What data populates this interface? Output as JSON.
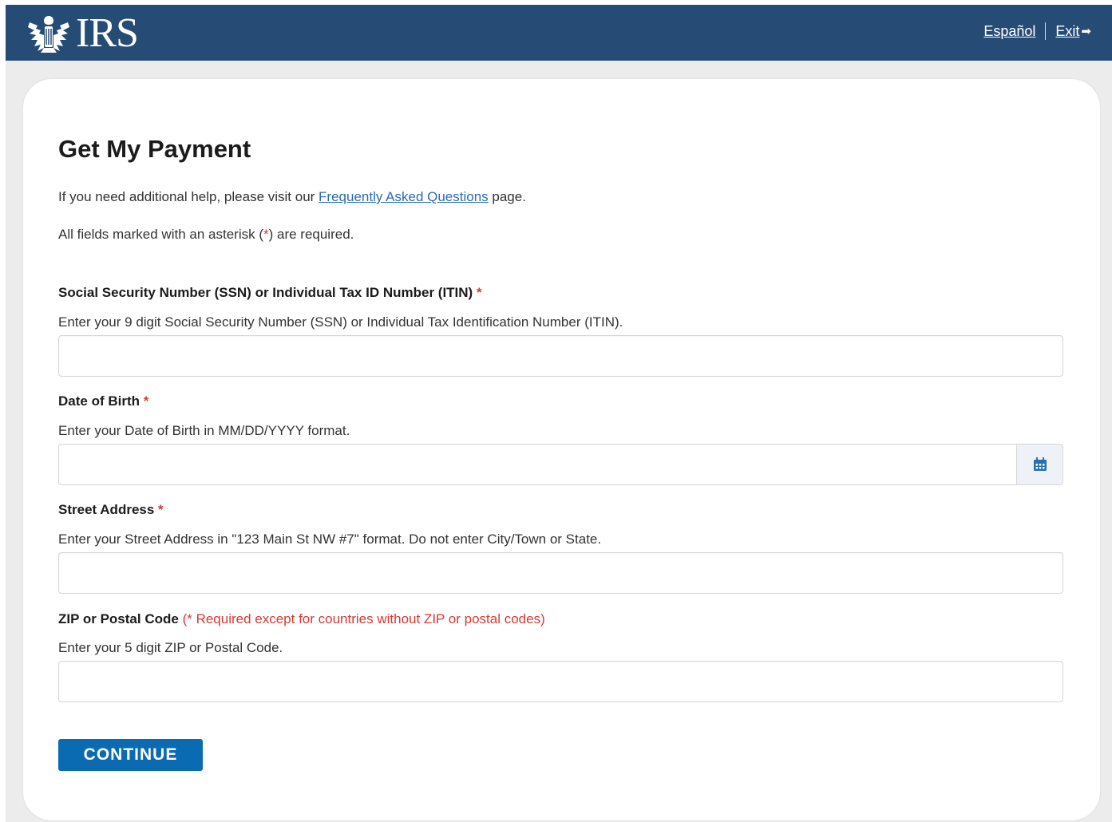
{
  "header": {
    "logo_text": "IRS",
    "espanol_link": "Español",
    "exit_link": "Exit"
  },
  "form": {
    "title": "Get My Payment",
    "help_prefix": "If you need additional help, please visit our ",
    "faq_link": "Frequently Asked Questions",
    "help_suffix": " page.",
    "required_prefix": "All fields marked with an asterisk (",
    "required_asterisk": "*",
    "required_suffix": ") are required.",
    "fields": [
      {
        "label": "Social Security Number (SSN) or Individual Tax ID Number (ITIN)",
        "asterisk": "*",
        "hint": "Enter your 9 digit Social Security Number (SSN) or Individual Tax Identification Number (ITIN).",
        "value": ""
      },
      {
        "label": "Date of Birth",
        "asterisk": "*",
        "hint": "Enter your Date of Birth in MM/DD/YYYY format.",
        "value": ""
      },
      {
        "label": "Street Address",
        "asterisk": "*",
        "hint": "Enter your Street Address in \"123 Main St NW #7\" format. Do not enter City/Town or State.",
        "value": ""
      },
      {
        "label": "ZIP or Postal Code",
        "note": "(* Required except for countries without ZIP or postal codes)",
        "hint": "Enter your 5 digit ZIP or Postal Code.",
        "value": ""
      }
    ],
    "continue_label": "CONTINUE"
  },
  "colors": {
    "header_bg": "#264b75",
    "primary_button": "#0a6bb3",
    "link": "#2a6db0",
    "required": "#d83933"
  }
}
